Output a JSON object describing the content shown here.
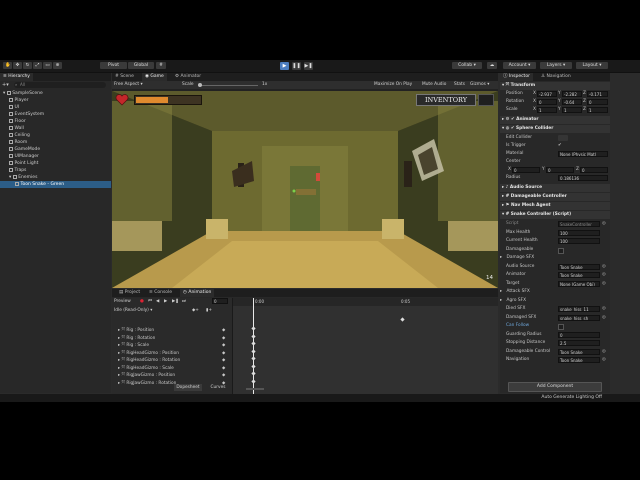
{
  "toolbar": {
    "pivot": "Pivot",
    "global": "Global",
    "collab": "Collab",
    "account": "Account",
    "layers": "Layers",
    "layout": "Layout"
  },
  "hierarchy": {
    "tab": "Hierarchy",
    "search_placeholder": "All",
    "items": [
      {
        "label": "SampleScene",
        "level": 0,
        "selected": false
      },
      {
        "label": "Player",
        "level": 1,
        "selected": false
      },
      {
        "label": "UI",
        "level": 1,
        "selected": false
      },
      {
        "label": "EventSystem",
        "level": 1,
        "selected": false
      },
      {
        "label": "Floor",
        "level": 1,
        "selected": false
      },
      {
        "label": "Wall",
        "level": 1,
        "selected": false
      },
      {
        "label": "Ceiling",
        "level": 1,
        "selected": false
      },
      {
        "label": "Room",
        "level": 1,
        "selected": false
      },
      {
        "label": "GameMode",
        "level": 1,
        "selected": false
      },
      {
        "label": "UIManager",
        "level": 1,
        "selected": false
      },
      {
        "label": "Point Light",
        "level": 1,
        "selected": false
      },
      {
        "label": "Traps",
        "level": 1,
        "selected": false
      },
      {
        "label": "Enemies",
        "level": 1,
        "selected": false
      },
      {
        "label": "Toon Snake - Green",
        "level": 2,
        "selected": true
      }
    ]
  },
  "view_tabs": {
    "scene": "Scene",
    "game": "Game",
    "animator": "Animator"
  },
  "game_bar": {
    "aspect": "Free Aspect",
    "scale_label": "Scale",
    "scale_value": "1x",
    "maximize": "Maximize On Play",
    "mute": "Mute Audio",
    "stats": "Stats",
    "gizmos": "Gizmos"
  },
  "game": {
    "inventory": "INVENTORY",
    "counter": "14"
  },
  "bottom_tabs": {
    "project": "Project",
    "console": "Console",
    "animation": "Animation"
  },
  "animation": {
    "preview": "Preview",
    "frame": "0",
    "clip": "Idle (Read-Only)",
    "timeline_start": "0:00",
    "timeline_mid": "0:05",
    "properties": [
      "Rig : Position",
      "Rig : Rotation",
      "Rig : Scale",
      "RigHeadGizmo : Position",
      "RigHeadGizmo : Rotation",
      "RigHeadGizmo : Scale",
      "RigJawGizmo : Position",
      "RigJawGizmo : Rotation"
    ],
    "dopesheet": "Dopesheet",
    "curves": "Curves"
  },
  "inspector": {
    "tab": "Inspector",
    "tab2": "Navigation",
    "transform": {
      "title": "Transform",
      "position_label": "Position",
      "rotation_label": "Rotation",
      "scale_label": "Scale",
      "position": {
        "x": "-2.937",
        "y": "-2.282",
        "z": "-0.171"
      },
      "rotation": {
        "x": "0",
        "y": "-0.64",
        "z": "0"
      },
      "scale": {
        "x": "1",
        "y": "1",
        "z": "1"
      }
    },
    "animator": "Animator",
    "sphere_collider": {
      "title": "Sphere Collider",
      "edit_collider": "Edit Collider",
      "is_trigger": "Is Trigger",
      "material_label": "Material",
      "material_value": "None (Physic Mat)",
      "center_label": "Center",
      "center": {
        "x": "0",
        "y": "0",
        "z": "0"
      },
      "radius_label": "Radius",
      "radius_value": "0.186136"
    },
    "audio_source": "Audio Source",
    "damageable": "Damageable Controller",
    "nav_mesh": "Nav Mesh Agent",
    "snake": {
      "title": "Snake Controller (Script)",
      "script_label": "Script",
      "script_value": "SnakeController",
      "max_health_label": "Max Health",
      "max_health": "100",
      "current_health_label": "Current Health",
      "current_health": "100",
      "damageable_label": "Damageable",
      "damage_sfx": "Damage SFX",
      "audio_source_label": "Audio Source",
      "audio_source_value": "Toon Snake",
      "animator_label": "Animator",
      "animator_value": "Toon Snake",
      "target_label": "Target",
      "target_value": "None (Game Obj)",
      "attack_sfx": "Attack SFX",
      "agro_sfx": "Agro SFX",
      "died_sfx_label": "Died SFX",
      "died_sfx_value": "snake_hiss_11",
      "damaged_sfx_label": "Damaged SFX",
      "damaged_sfx_value": "snake_hiss_sh",
      "can_follow_label": "Can Follow",
      "guarding_radius_label": "Guarding Radius",
      "guarding_radius": "0",
      "stopping_distance_label": "Stopping Distance",
      "stopping_distance": "2.5",
      "damageable_control_label": "Damageable Control",
      "damageable_control_value": "Toon Snake",
      "navigation_label": "Navigation",
      "navigation_value": "Toon Snake"
    },
    "add_component": "Add Component"
  },
  "status": {
    "lighting": "Auto Generate Lighting Off"
  }
}
